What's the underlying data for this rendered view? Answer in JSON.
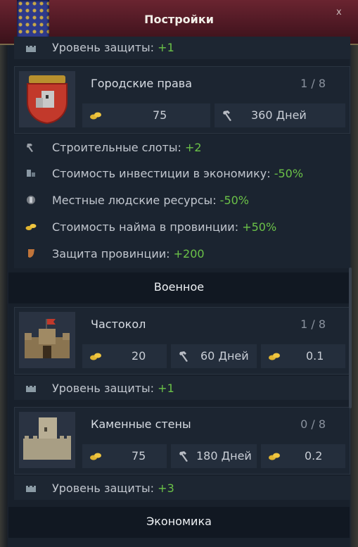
{
  "window": {
    "title": "Постройки",
    "close_label": "x"
  },
  "top_row": {
    "label": "Уровень защиты:",
    "value": "+1"
  },
  "city_rights": {
    "name": "Городские права",
    "level": "1 / 8",
    "cost": "75",
    "time": "360 Дней",
    "effects": [
      {
        "icon": "hammer-icon",
        "label": "Строительные слоты:",
        "value": "+2"
      },
      {
        "icon": "economy-icon",
        "label": "Стоимость инвестиции в экономику:",
        "value": "-50%"
      },
      {
        "icon": "manpower-icon",
        "label": "Местные людские ресурсы:",
        "value": "-50%"
      },
      {
        "icon": "gold-coins-icon",
        "label": "Стоимость найма в провинции:",
        "value": "+50%"
      },
      {
        "icon": "shield-icon",
        "label": "Защита провинции:",
        "value": "+200"
      }
    ]
  },
  "sections": {
    "military": "Военное",
    "economy": "Экономика"
  },
  "palisade": {
    "name": "Частокол",
    "level": "1 / 8",
    "cost": "20",
    "time": "60 Дней",
    "upkeep": "0.1",
    "effect": {
      "label": "Уровень защиты:",
      "value": "+1"
    }
  },
  "stone_walls": {
    "name": "Каменные стены",
    "level": "0 / 8",
    "cost": "75",
    "time": "180 Дней",
    "upkeep": "0.2",
    "effect": {
      "label": "Уровень защиты:",
      "value": "+3"
    }
  },
  "colors": {
    "accent_green": "#6bc248",
    "header_red": "#4d1823"
  }
}
